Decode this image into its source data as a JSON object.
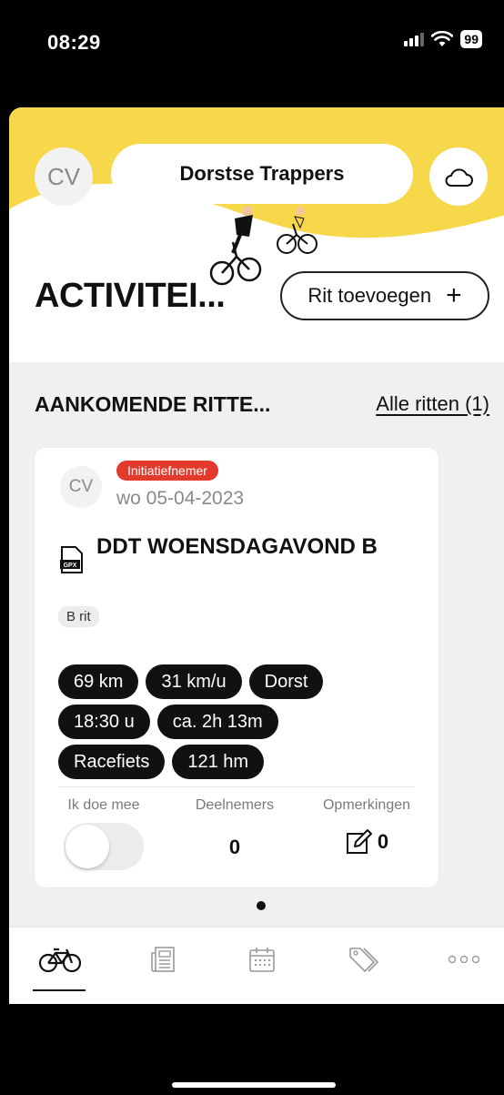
{
  "status_bar": {
    "time": "08:29",
    "battery": "99"
  },
  "header": {
    "avatar_initials": "CV",
    "club_name": "Dorstse Trappers"
  },
  "activities": {
    "title": "ACTIVITEI...",
    "add_ride_label": "Rit toevoegen",
    "add_icon": "+"
  },
  "upcoming": {
    "title": "AANKOMENDE RITTE...",
    "all_rides_link": "Alle ritten (1)"
  },
  "ride_card": {
    "avatar_initials": "CV",
    "badge": "Initiatiefnemer",
    "date": "wo 05-04-2023",
    "title": "DDT WOENSDAGAVOND B",
    "tag": "B rit",
    "chips": [
      [
        "69 km",
        "31 km/u",
        "Dorst"
      ],
      [
        "18:30 u",
        "ca. 2h 13m"
      ],
      [
        "Racefiets",
        "121 hm"
      ]
    ],
    "footer": {
      "join_label": "Ik doe mee",
      "join_toggle_on": false,
      "participants_label": "Deelnemers",
      "participants_count": "0",
      "remarks_label": "Opmerkingen",
      "remarks_count": "0"
    }
  },
  "tabbar": {
    "tabs": [
      {
        "icon": "bicycle-icon",
        "active": true
      },
      {
        "icon": "newspaper-icon",
        "active": false
      },
      {
        "icon": "calendar-icon",
        "active": false
      },
      {
        "icon": "tags-icon",
        "active": false
      },
      {
        "icon": "more-icon",
        "active": false
      }
    ]
  },
  "colors": {
    "brand_yellow": "#f6d84a",
    "badge_red": "#e23b2e",
    "chip_black": "#111111"
  }
}
